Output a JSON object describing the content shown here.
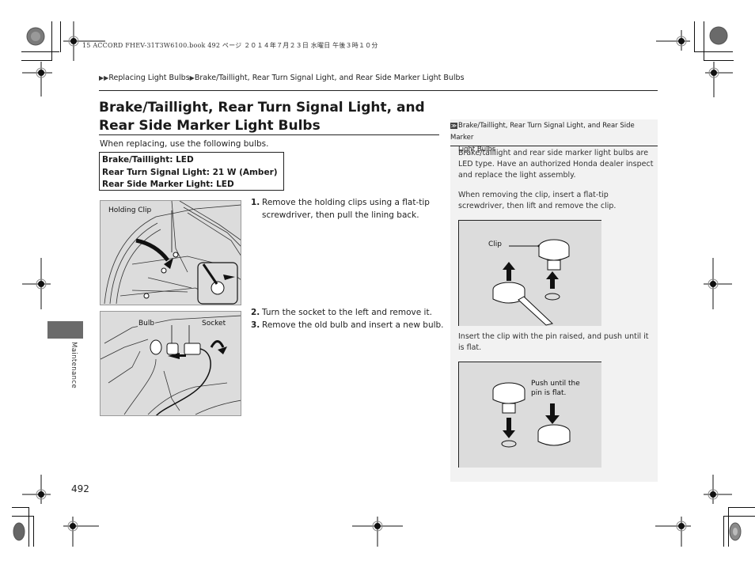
{
  "print_header": "15 ACCORD FHEV-31T3W6100.book  492 ページ  ２０１４年７月２３日  水曜日  午後３時１０分",
  "breadcrumb": {
    "marker": "▶▶",
    "parent": "Replacing Light Bulbs",
    "separator": "▶",
    "current": "Brake/Taillight, Rear Turn Signal Light, and Rear Side Marker Light Bulbs"
  },
  "page_title": "Brake/Taillight, Rear Turn Signal Light, and Rear Side Marker Light Bulbs",
  "intro": "When replacing, use the following bulbs.",
  "bulb_specs": [
    "Brake/Taillight: LED",
    "Rear Turn Signal Light: 21 W (Amber)",
    "Rear Side Marker Light: LED"
  ],
  "figures": {
    "holding_clip_label": "Holding Clip",
    "bulb_label": "Bulb",
    "socket_label": "Socket",
    "clip_label": "Clip",
    "push_label_line1": "Push until the",
    "push_label_line2": "pin is flat."
  },
  "steps": [
    {
      "num": "1.",
      "text": "Remove the holding clips using a flat-tip screwdriver, then pull the lining back."
    },
    {
      "num": "2.",
      "text": "Turn the socket to the left and remove it."
    },
    {
      "num": "3.",
      "text": "Remove the old bulb and insert a new bulb."
    }
  ],
  "sidebar": {
    "icon": "≫",
    "heading_line1": "Brake/Taillight, Rear Turn Signal Light, and Rear Side Marker",
    "heading_line2": "Light Bulbs",
    "para1": "Brake/taillight and rear side marker light bulbs are LED type. Have an authorized Honda dealer inspect and replace the light assembly.",
    "para2": "When removing the clip, insert a flat-tip screwdriver, then lift and remove the clip.",
    "para3": "Insert the clip with the pin raised, and push until it is flat."
  },
  "section_tab": "Maintenance",
  "page_number": "492"
}
